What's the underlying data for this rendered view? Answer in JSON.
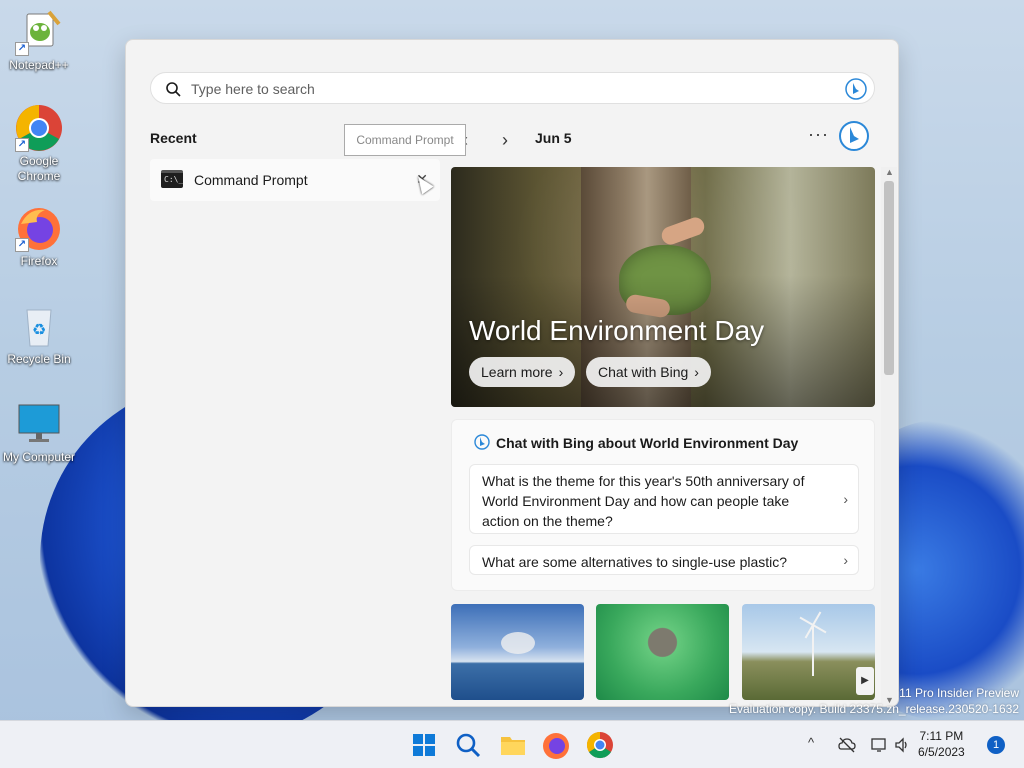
{
  "desktop": {
    "icons": [
      {
        "label": "Notepad++"
      },
      {
        "label": "Google Chrome"
      },
      {
        "label": "Firefox"
      },
      {
        "label": "Recycle Bin"
      },
      {
        "label": "My Computer"
      }
    ]
  },
  "search": {
    "placeholder": "Type here to search"
  },
  "recent": {
    "title": "Recent",
    "items": [
      {
        "label": "Command Prompt",
        "remove_glyph": "✕"
      }
    ]
  },
  "tooltip": {
    "text": "Command Prompt"
  },
  "highlights": {
    "prev_glyph": "‹",
    "next_glyph": "›",
    "date": "Jun 5",
    "more_glyph": "···",
    "hero": {
      "title": "World Environment Day",
      "buttons": [
        {
          "label": "Learn more",
          "chevron": "›"
        },
        {
          "label": "Chat with Bing",
          "chevron": "›"
        }
      ]
    },
    "chat_card": {
      "title": "Chat with Bing about World Environment Day",
      "questions": [
        {
          "text": "What is the theme for this year's 50th anniversary of World Environment Day and how can people take action on the theme?",
          "chevron": "›"
        },
        {
          "text": "What are some alternatives to single-use plastic?",
          "chevron": "›"
        }
      ]
    }
  },
  "watermark": {
    "line1": "11 Pro Insider Preview",
    "line2": "Evaluation copy. Build 23375.zn_release.230520-1632"
  },
  "taskbar": {
    "tray": {
      "chevron": "^",
      "clock_time": "7:11 PM",
      "clock_date": "6/5/2023",
      "notification_count": "1"
    }
  },
  "colors": {
    "accent": "#0f60c5",
    "flyout_bg": "#f3f3f3",
    "taskbar_bg": "#eef0f5"
  }
}
